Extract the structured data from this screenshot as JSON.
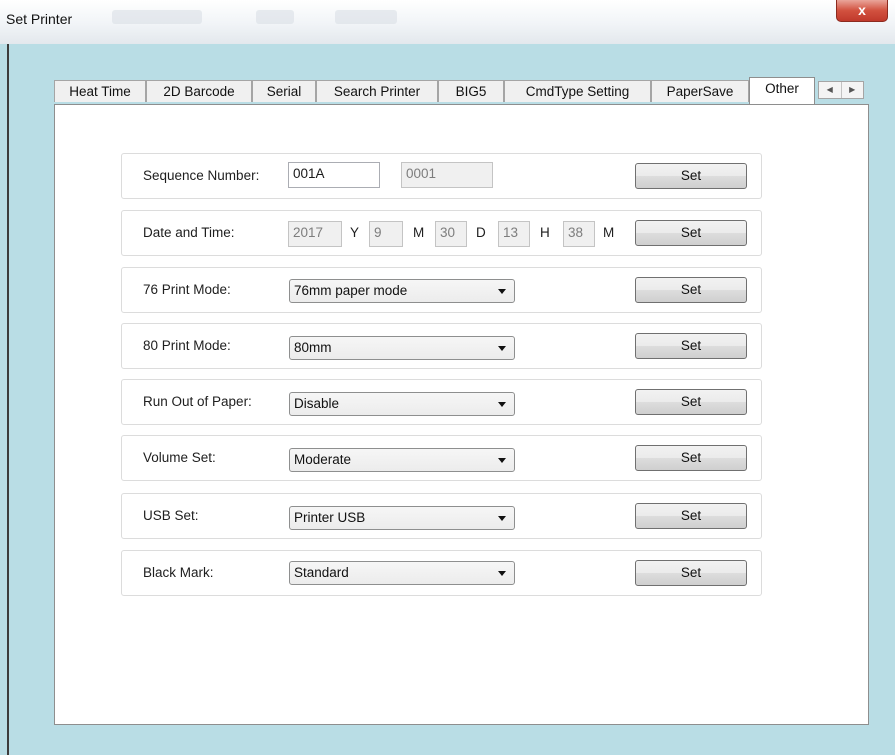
{
  "window": {
    "title": "Set Printer",
    "close_glyph": "x"
  },
  "tabs": [
    {
      "label": "Heat Time"
    },
    {
      "label": "2D Barcode"
    },
    {
      "label": "Serial"
    },
    {
      "label": "Search Printer"
    },
    {
      "label": "BIG5"
    },
    {
      "label": "CmdType Setting"
    },
    {
      "label": "PaperSave"
    },
    {
      "label": "Other",
      "active": true
    }
  ],
  "tab_scroll": {
    "left_icon": "scroll-left-icon",
    "right_icon": "scroll-right-icon"
  },
  "rows": {
    "sequence": {
      "label": "Sequence Number:",
      "value": "001A",
      "readonly_value": "0001",
      "button": "Set"
    },
    "datetime": {
      "label": "Date and Time:",
      "year": "2017",
      "year_unit": "Y",
      "month": "9",
      "month_unit": "M",
      "day": "30",
      "day_unit": "D",
      "hour": "13",
      "hour_unit": "H",
      "minute": "38",
      "minute_unit": "M",
      "button": "Set"
    },
    "print76": {
      "label": "76 Print Mode:",
      "selected": "76mm paper mode",
      "button": "Set"
    },
    "print80": {
      "label": "80 Print Mode:",
      "selected": "80mm",
      "button": "Set"
    },
    "paper_out": {
      "label": "Run Out of Paper:",
      "selected": "Disable",
      "button": "Set"
    },
    "volume": {
      "label": "Volume Set:",
      "selected": "Moderate",
      "button": "Set"
    },
    "usb": {
      "label": "USB Set:",
      "selected": "Printer USB",
      "button": "Set"
    },
    "black_mark": {
      "label": "Black Mark:",
      "selected": "Standard",
      "button": "Set"
    }
  },
  "colors": {
    "background": "#b9dde5",
    "close_button": "#c0392b"
  }
}
